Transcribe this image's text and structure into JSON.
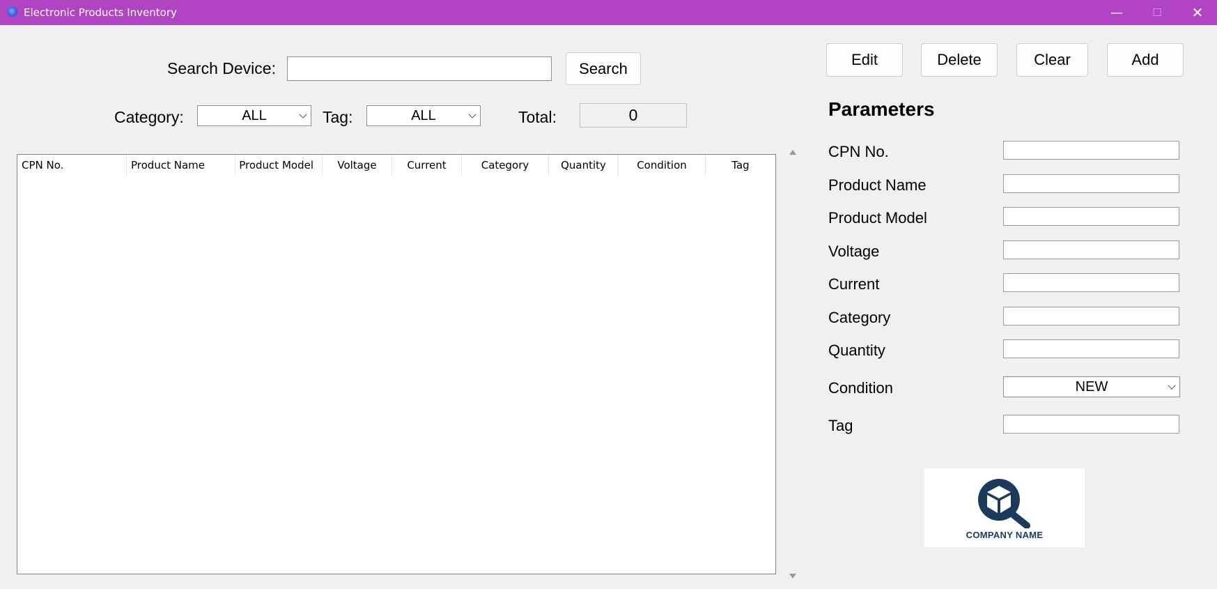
{
  "window": {
    "title": "Electronic Products Inventory",
    "minimize_glyph": "—",
    "maximize_glyph": "☐",
    "close_glyph": "✕"
  },
  "search": {
    "label": "Search Device:",
    "value": "",
    "button_label": "Search"
  },
  "filters": {
    "category_label": "Category:",
    "category_value": "ALL",
    "tag_label": "Tag:",
    "tag_value": "ALL",
    "total_label": "Total:",
    "total_value": "0"
  },
  "table": {
    "columns": [
      "CPN No.",
      "Product Name",
      "Product Model",
      "Voltage",
      "Current",
      "Category",
      "Quantity",
      "Condition",
      "Tag"
    ],
    "rows": []
  },
  "actions": {
    "edit": "Edit",
    "delete": "Delete",
    "clear": "Clear",
    "add": "Add"
  },
  "parameters": {
    "title": "Parameters",
    "fields": [
      {
        "label": "CPN No.",
        "value": ""
      },
      {
        "label": "Product Name",
        "value": ""
      },
      {
        "label": "Product Model",
        "value": ""
      },
      {
        "label": "Voltage",
        "value": ""
      },
      {
        "label": "Current",
        "value": ""
      },
      {
        "label": "Category",
        "value": ""
      },
      {
        "label": "Quantity",
        "value": ""
      },
      {
        "label": "Condition",
        "value": "NEW"
      },
      {
        "label": "Tag",
        "value": ""
      }
    ]
  },
  "logo": {
    "text": "COMPANY NAME",
    "color": "#1b3a5c"
  },
  "colors": {
    "titlebar": "#b044c2",
    "background": "#f0f0f0"
  }
}
